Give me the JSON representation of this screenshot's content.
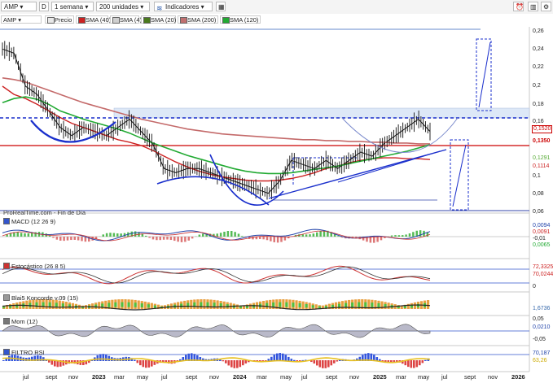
{
  "toolbar": {
    "symbol": "AMP",
    "period_btn": "D",
    "timeframe": "1 semana",
    "units": "200 unidades",
    "indicators": "Indicadores"
  },
  "legend": [
    {
      "label": "Precio",
      "color": "#e8e8e8"
    },
    {
      "label": "SMA (40)",
      "color": "#cc2222"
    },
    {
      "label": "SMA (4)",
      "color": "#cfcfcf"
    },
    {
      "label": "SMA (20)",
      "color": "#4a7a1e"
    },
    {
      "label": "SMA (200)",
      "color": "#c07070"
    },
    {
      "label": "SMA (120)",
      "color": "#22aa33"
    }
  ],
  "source_note": "ProRealTime.com - Fin de Día",
  "panels": {
    "macd": "MACD (12 26 9)",
    "stoch": "Estocástico (26 8 5)",
    "koncorde": "Blai5 Koncorde v.09 (15)",
    "mom": "Mom (12)",
    "rsi": "FILTRO RSI"
  },
  "price_axis": [
    "0,26",
    "0,24",
    "0,22",
    "0,2",
    "0,18",
    "0,16",
    "0,1",
    "0,08",
    "0,06"
  ],
  "price_tags": [
    {
      "text": "0,1520",
      "color": "#cc0000"
    },
    {
      "text": "0,1350",
      "color": "#cc0000"
    },
    {
      "text": "0,1291",
      "color": "#55aa33"
    },
    {
      "text": "0,1114",
      "color": "#cc2222"
    }
  ],
  "macd_axis": [
    "0,0094",
    "0,0091",
    "-0,01",
    "0,0065"
  ],
  "stoch_axis": [
    "72,3325",
    "70,0244",
    "0"
  ],
  "koncorde_axis": [
    "1,6736"
  ],
  "mom_axis": [
    "0,05",
    "0,0210",
    "-0,05"
  ],
  "rsi_axis": [
    "70,187",
    "63,26"
  ],
  "x_axis": [
    "jul",
    "sept",
    "nov",
    "2023",
    "mar",
    "may",
    "jul",
    "sept",
    "nov",
    "2024",
    "mar",
    "may",
    "jul",
    "sept",
    "nov",
    "2025",
    "mar",
    "may",
    "jul",
    "sept",
    "nov",
    "2026"
  ],
  "x_bold": [
    "2023",
    "2024",
    "2025",
    "2026"
  ],
  "chart_data": {
    "type": "line",
    "title": "AMP",
    "ylim": [
      0.05,
      0.27
    ],
    "price_tags": [
      0.152,
      0.135,
      0.1291,
      0.1114
    ],
    "series": [
      {
        "name": "Precio",
        "values": [
          0.245,
          0.24,
          0.2,
          0.19,
          0.17,
          0.15,
          0.14,
          0.15,
          0.145,
          0.14,
          0.15,
          0.16,
          0.145,
          0.13,
          0.1,
          0.095,
          0.1,
          0.1,
          0.095,
          0.09,
          0.085,
          0.08,
          0.075,
          0.07,
          0.085,
          0.11,
          0.105,
          0.1,
          0.11,
          0.1,
          0.11,
          0.12,
          0.115,
          0.13,
          0.14,
          0.15,
          0.16,
          0.145
        ]
      },
      {
        "name": "SMA (40)",
        "values": [
          0.2,
          0.19,
          0.185,
          0.178,
          0.17,
          0.162,
          0.155,
          0.15,
          0.145,
          0.14,
          0.135,
          0.132,
          0.128,
          0.122,
          0.115,
          0.108,
          0.102,
          0.097,
          0.093,
          0.09,
          0.088,
          0.086,
          0.085,
          0.085,
          0.086,
          0.088,
          0.091,
          0.095,
          0.1,
          0.103,
          0.107,
          0.11,
          0.112,
          0.113,
          0.113,
          0.112,
          0.112,
          0.111
        ]
      },
      {
        "name": "SMA (200)",
        "values": [
          0.21,
          0.208,
          0.205,
          0.2,
          0.195,
          0.19,
          0.185,
          0.18,
          0.176,
          0.172,
          0.168,
          0.164,
          0.16,
          0.157,
          0.154,
          0.151,
          0.148,
          0.146,
          0.144,
          0.142,
          0.141,
          0.14,
          0.139,
          0.138,
          0.137,
          0.136,
          0.135,
          0.135,
          0.134,
          0.134,
          0.133,
          0.133,
          0.132,
          0.132,
          0.131,
          0.131,
          0.13,
          0.13
        ]
      },
      {
        "name": "SMA (120)",
        "values": [
          0.18,
          0.185,
          0.187,
          0.184,
          0.178,
          0.17,
          0.165,
          0.16,
          0.156,
          0.152,
          0.148,
          0.143,
          0.137,
          0.131,
          0.126,
          0.121,
          0.116,
          0.112,
          0.108,
          0.104,
          0.1,
          0.097,
          0.095,
          0.094,
          0.094,
          0.095,
          0.097,
          0.099,
          0.101,
          0.103,
          0.106,
          0.109,
          0.112,
          0.115,
          0.118,
          0.121,
          0.125,
          0.129
        ]
      }
    ]
  }
}
